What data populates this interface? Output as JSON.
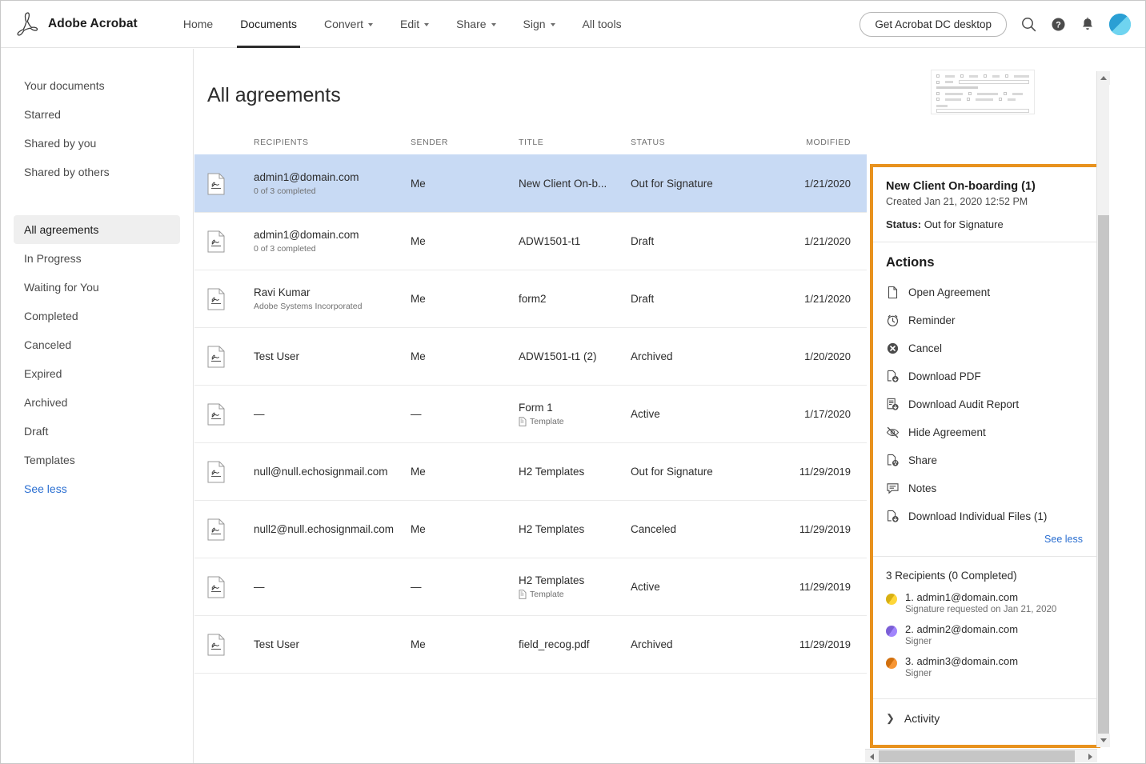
{
  "header": {
    "brand": "Adobe Acrobat",
    "logo_icon": "acrobat-logo-icon",
    "nav": [
      {
        "label": "Home",
        "has_caret": false,
        "active": false
      },
      {
        "label": "Documents",
        "has_caret": false,
        "active": true
      },
      {
        "label": "Convert",
        "has_caret": true,
        "active": false
      },
      {
        "label": "Edit",
        "has_caret": true,
        "active": false
      },
      {
        "label": "Share",
        "has_caret": true,
        "active": false
      },
      {
        "label": "Sign",
        "has_caret": true,
        "active": false
      },
      {
        "label": "All tools",
        "has_caret": false,
        "active": false
      }
    ],
    "desktop_button": "Get Acrobat DC desktop",
    "icons": [
      "search-icon",
      "help-icon",
      "notifications-icon",
      "user-avatar"
    ]
  },
  "sidebar": {
    "group1": [
      {
        "label": "Your documents"
      },
      {
        "label": "Starred"
      },
      {
        "label": "Shared by you"
      },
      {
        "label": "Shared by others"
      }
    ],
    "group2": [
      {
        "label": "All agreements",
        "selected": true
      },
      {
        "label": "In Progress",
        "selected": false
      },
      {
        "label": "Waiting for You",
        "selected": false
      },
      {
        "label": "Completed",
        "selected": false
      },
      {
        "label": "Canceled",
        "selected": false
      },
      {
        "label": "Expired",
        "selected": false
      },
      {
        "label": "Archived",
        "selected": false
      },
      {
        "label": "Draft",
        "selected": false
      },
      {
        "label": "Templates",
        "selected": false
      }
    ],
    "see_less": "See less"
  },
  "main": {
    "title": "All agreements",
    "columns": {
      "recipients": "RECIPIENTS",
      "sender": "SENDER",
      "title": "TITLE",
      "status": "STATUS",
      "modified": "MODIFIED"
    },
    "rows": [
      {
        "recipient": "admin1@domain.com",
        "recipient_sub": "0 of 3 completed",
        "sender": "Me",
        "title": "New Client On-b...",
        "title_sub": "",
        "status": "Out for Signature",
        "modified": "1/21/2020",
        "selected": true
      },
      {
        "recipient": "admin1@domain.com",
        "recipient_sub": "0 of 3 completed",
        "sender": "Me",
        "title": "ADW1501-t1",
        "title_sub": "",
        "status": "Draft",
        "modified": "1/21/2020",
        "selected": false
      },
      {
        "recipient": "Ravi Kumar",
        "recipient_sub": "Adobe Systems Incorporated",
        "sender": "Me",
        "title": "form2",
        "title_sub": "",
        "status": "Draft",
        "modified": "1/21/2020",
        "selected": false
      },
      {
        "recipient": "Test User",
        "recipient_sub": "",
        "sender": "Me",
        "title": "ADW1501-t1 (2)",
        "title_sub": "",
        "status": "Archived",
        "modified": "1/20/2020",
        "selected": false
      },
      {
        "recipient": "—",
        "recipient_sub": "",
        "sender": "—",
        "title": "Form 1",
        "title_sub": "Template",
        "status": "Active",
        "modified": "1/17/2020",
        "selected": false
      },
      {
        "recipient": "null@null.echosignmail.com",
        "recipient_sub": "",
        "sender": "Me",
        "title": "H2 Templates",
        "title_sub": "",
        "status": "Out for Signature",
        "modified": "11/29/2019",
        "selected": false
      },
      {
        "recipient": "null2@null.echosignmail.com",
        "recipient_sub": "",
        "sender": "Me",
        "title": "H2 Templates",
        "title_sub": "",
        "status": "Canceled",
        "modified": "11/29/2019",
        "selected": false
      },
      {
        "recipient": "—",
        "recipient_sub": "",
        "sender": "—",
        "title": "H2 Templates",
        "title_sub": "Template",
        "status": "Active",
        "modified": "11/29/2019",
        "selected": false
      },
      {
        "recipient": "Test User",
        "recipient_sub": "",
        "sender": "Me",
        "title": "field_recog.pdf",
        "title_sub": "",
        "status": "Archived",
        "modified": "11/29/2019",
        "selected": false
      }
    ]
  },
  "details_panel": {
    "highlight_color": "#e8921e",
    "agreement_title": "New Client On-boarding (1)",
    "created": "Created Jan 21, 2020 12:52 PM",
    "status_label": "Status:",
    "status_value": "Out for Signature",
    "actions_heading": "Actions",
    "actions": [
      {
        "label": "Open Agreement",
        "icon": "document-icon"
      },
      {
        "label": "Reminder",
        "icon": "clock-icon"
      },
      {
        "label": "Cancel",
        "icon": "cancel-circle-icon"
      },
      {
        "label": "Download PDF",
        "icon": "download-pdf-icon"
      },
      {
        "label": "Download Audit Report",
        "icon": "download-audit-icon"
      },
      {
        "label": "Hide Agreement",
        "icon": "eye-slash-icon"
      },
      {
        "label": "Share",
        "icon": "share-icon"
      },
      {
        "label": "Notes",
        "icon": "notes-icon"
      },
      {
        "label": "Download Individual Files (1)",
        "icon": "download-files-icon"
      }
    ],
    "see_less": "See less",
    "recipients_heading": "3 Recipients (0 Completed)",
    "recipients": [
      {
        "name": "1. admin1@domain.com",
        "sub": "Signature requested on Jan 21, 2020",
        "color": "#d8b012"
      },
      {
        "name": "2. admin2@domain.com",
        "sub": "Signer",
        "color": "#7b5fd6"
      },
      {
        "name": "3. admin3@domain.com",
        "sub": "Signer",
        "color": "#d1700e"
      }
    ],
    "activity_label": "Activity"
  },
  "thumbnail": {
    "name": "document-thumbnail-preview"
  }
}
